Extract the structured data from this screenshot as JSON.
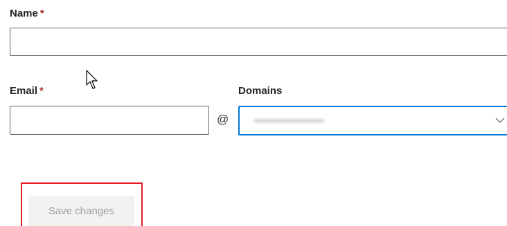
{
  "form": {
    "name": {
      "label": "Name",
      "required_mark": "*",
      "value": ""
    },
    "email": {
      "label": "Email",
      "required_mark": "*",
      "value": ""
    },
    "at_symbol": "@",
    "domains": {
      "label": "Domains",
      "selected_value": "••••••••••••••••••••",
      "value_obscured": true,
      "icon": "chevron-down-icon"
    },
    "save_button": {
      "label": "Save changes",
      "enabled": false
    }
  },
  "colors": {
    "required": "#a4262c",
    "focus_border": "#0078d4",
    "highlight_annotation": "#e11b22",
    "disabled_button_bg": "#f3f2f1",
    "disabled_button_text": "#a19f9d"
  }
}
